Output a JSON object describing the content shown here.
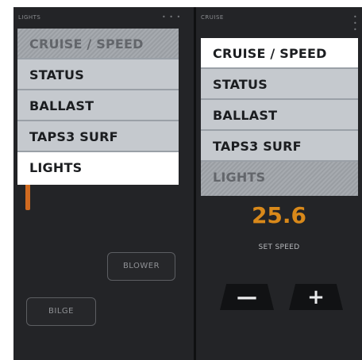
{
  "left_panel": {
    "title": "LIGHTS"
  },
  "right_panel": {
    "title": "CRUISE"
  },
  "header_menu_glyph": "• • •",
  "left_menu": {
    "items": [
      {
        "label": "CRUISE / SPEED",
        "state": "disabled"
      },
      {
        "label": "STATUS",
        "state": "normal"
      },
      {
        "label": "BALLAST",
        "state": "normal"
      },
      {
        "label": "TAPS3 SURF",
        "state": "normal"
      },
      {
        "label": "LIGHTS",
        "state": "active"
      }
    ]
  },
  "right_menu": {
    "items": [
      {
        "label": "CRUISE / SPEED",
        "state": "active"
      },
      {
        "label": "STATUS",
        "state": "normal"
      },
      {
        "label": "BALLAST",
        "state": "normal"
      },
      {
        "label": "TAPS3 SURF",
        "state": "normal"
      },
      {
        "label": "LIGHTS",
        "state": "disabled"
      }
    ]
  },
  "lights_controls": {
    "blower_label": "BLOWER",
    "bilge_label": "BILGE"
  },
  "cruise": {
    "set_speed_value": "25.6",
    "set_speed_label": "SET SPEED",
    "decrease_glyph": "—",
    "increase_glyph": "+"
  },
  "colors": {
    "accent_orange": "#d06a20",
    "speed_value": "#d9891a",
    "menu_item_bg": "#c5c9ce",
    "menu_active_bg": "#ffffff",
    "panel_bg": "#232427"
  }
}
